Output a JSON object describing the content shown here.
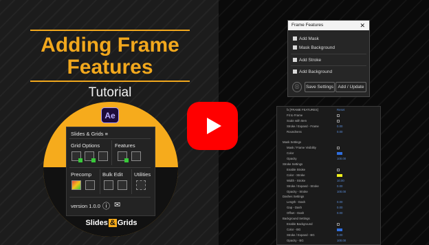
{
  "left": {
    "title_line1": "Adding Frame",
    "title_line2": "Features",
    "subtitle": "Tutorial",
    "ae_badge": "Ae",
    "panel": {
      "header": "Slides & Grids ≡",
      "grid_options": "Grid Options",
      "features": "Features",
      "precomp": "Precomp",
      "bulk_edit": "Bulk Edit",
      "utilities": "Utilities",
      "version": "version 1.0.0",
      "info_icon": "ⓘ",
      "mail_icon": "✉"
    },
    "logo": {
      "part1": "Slides",
      "part2": "&",
      "part3": "Grids"
    }
  },
  "play_button": {
    "icon": "youtube-play-icon",
    "color": "#ff0000"
  },
  "frame_features": {
    "title": "Frame Features",
    "close": "✕",
    "options": [
      "Add Mask",
      "Mask Background",
      "Add Stroke",
      "Add Background"
    ],
    "info_icon": "ⓘ",
    "save_button": "Save Settings",
    "add_button": "Add / Update"
  },
  "effect_controls": {
    "rows": [
      {
        "label": "fx  [FRAME FEATURES]",
        "value": "Reset",
        "kind": "text"
      },
      {
        "label": "Fit to Frame",
        "value": "",
        "kind": "check"
      },
      {
        "label": "Scale with Item",
        "value": "",
        "kind": "check"
      },
      {
        "label": "Stroke / Expand - Frame",
        "value": "0.00",
        "kind": "text"
      },
      {
        "label": "Roundness",
        "value": "0.00",
        "kind": "text"
      },
      {
        "label": "",
        "value": "",
        "kind": "none"
      },
      {
        "label": "Mask Settings",
        "value": "",
        "kind": "none"
      },
      {
        "label": "Mask / Frame Visibility",
        "value": "",
        "kind": "check"
      },
      {
        "label": "Color",
        "value": "#2f6fe0",
        "kind": "swatch"
      },
      {
        "label": "Opacity",
        "value": "100.00",
        "kind": "text"
      },
      {
        "label": "Stroke Settings",
        "value": "",
        "kind": "none"
      },
      {
        "label": "Enable Stroke",
        "value": "",
        "kind": "check"
      },
      {
        "label": "Color - Stroke",
        "value": "#f2f21c",
        "kind": "swatch"
      },
      {
        "label": "Width - Stroke",
        "value": "10.00",
        "kind": "text"
      },
      {
        "label": "Stroke / Expand - Stroke",
        "value": "0.00",
        "kind": "text"
      },
      {
        "label": "Opacity - Stroke",
        "value": "100.00",
        "kind": "text"
      },
      {
        "label": "Dashes Settings",
        "value": "",
        "kind": "none"
      },
      {
        "label": "Length - Dash",
        "value": "0.00",
        "kind": "text"
      },
      {
        "label": "Gap - Dash",
        "value": "0.00",
        "kind": "text"
      },
      {
        "label": "Offset - Dash",
        "value": "0.00",
        "kind": "text"
      },
      {
        "label": "Background Settings",
        "value": "",
        "kind": "none"
      },
      {
        "label": "Enable Background",
        "value": "",
        "kind": "check"
      },
      {
        "label": "Color - BG",
        "value": "#2f6fe0",
        "kind": "swatch"
      },
      {
        "label": "Stroke / Expand - BG",
        "value": "0.00",
        "kind": "text"
      },
      {
        "label": "Opacity - BG",
        "value": "100.00",
        "kind": "text"
      }
    ]
  }
}
